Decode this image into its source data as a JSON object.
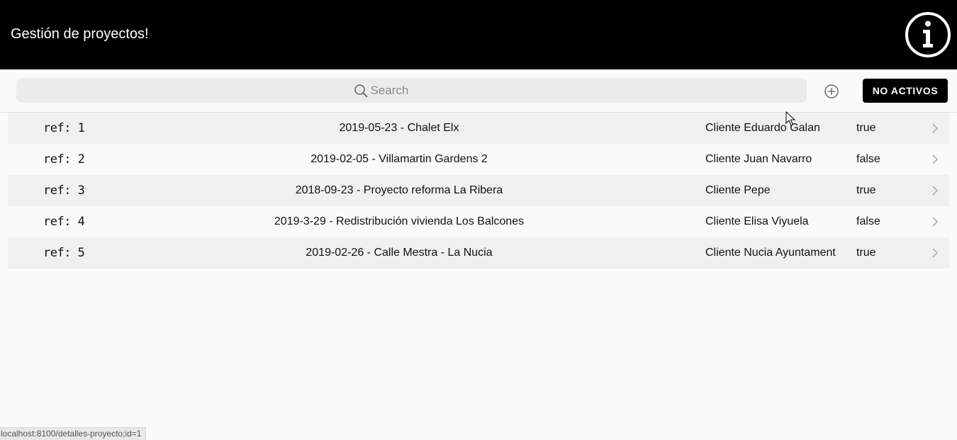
{
  "header": {
    "title": "Gestión de proyectos!",
    "info_icon": "info-circle-icon"
  },
  "toolbar": {
    "search_placeholder": "Search",
    "search_value": "",
    "add_icon": "plus-circle-icon",
    "no_activos_label": "NO ACTIVOS"
  },
  "projects": [
    {
      "ref": "ref: 1",
      "name": "2019-05-23 - Chalet Elx",
      "client": "Cliente Eduardo Galan",
      "active": "true"
    },
    {
      "ref": "ref: 2",
      "name": "2019-02-05 - Villamartin Gardens 2",
      "client": "Cliente Juan Navarro",
      "active": "false"
    },
    {
      "ref": "ref: 3",
      "name": "2018-09-23 - Proyecto reforma La Ribera",
      "client": "Cliente Pepe",
      "active": "true"
    },
    {
      "ref": "ref: 4",
      "name": "2019-3-29 - Redistribución vivienda Los Balcones",
      "client": "Cliente Elisa Viyuela",
      "active": "false"
    },
    {
      "ref": "ref: 5",
      "name": "2019-02-26 - Calle Mestra - La Nucia",
      "client": "Cliente Nucia Ayuntament",
      "active": "true"
    }
  ],
  "status_bar": {
    "url": "localhost:8100/detalles-proyecto;id=1"
  },
  "colors": {
    "header_bg": "#000000",
    "row_alt_bg": "#eff0ef",
    "button_bg": "#000000"
  }
}
